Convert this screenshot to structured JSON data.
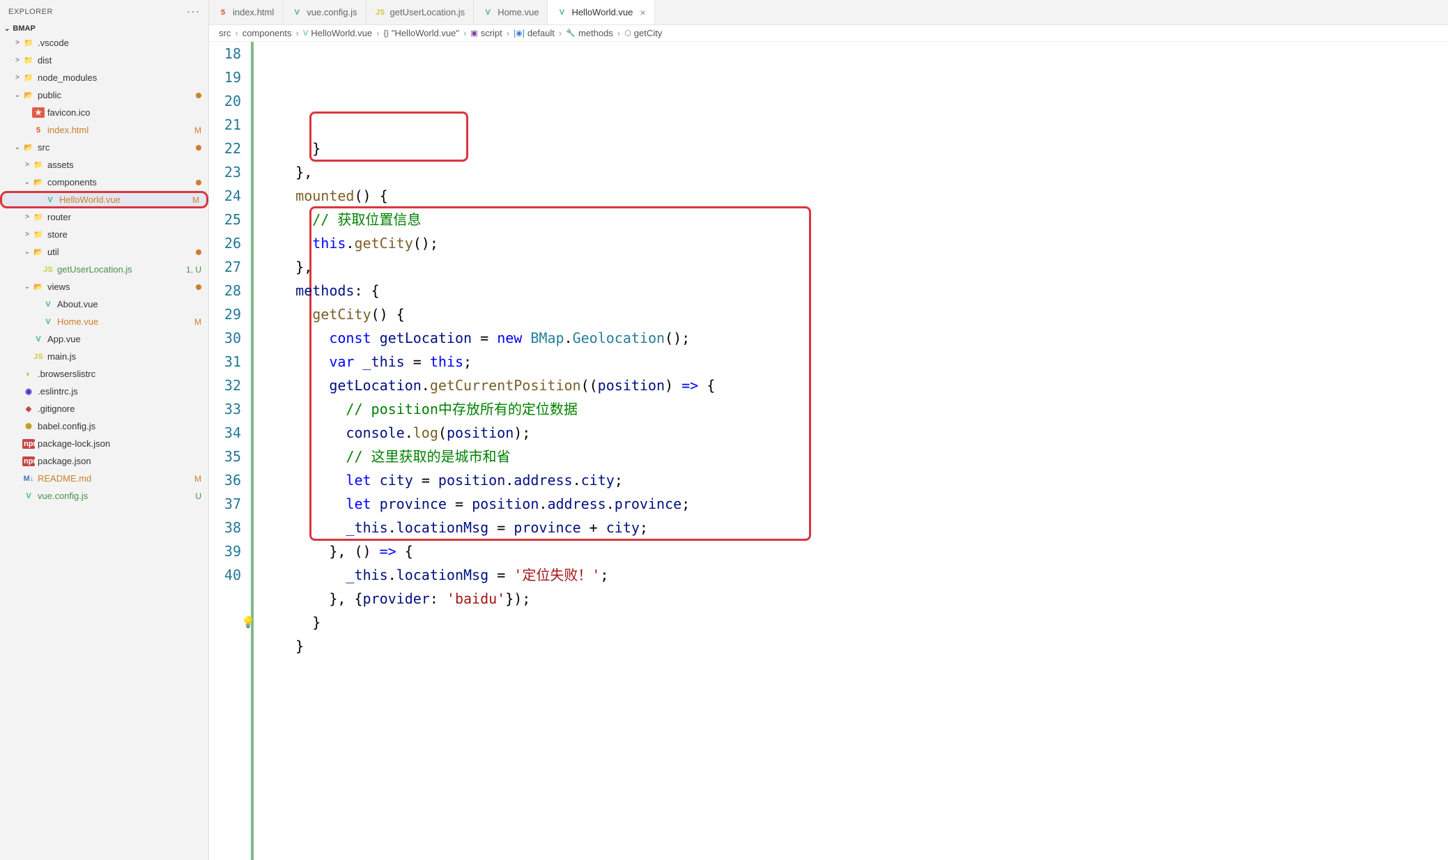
{
  "sidebar": {
    "title": "EXPLORER",
    "project": "BMAP",
    "tree": [
      {
        "indent": 1,
        "chev": ">",
        "icon": "📁",
        "iconClass": "",
        "label": ".vscode"
      },
      {
        "indent": 1,
        "chev": ">",
        "icon": "📁",
        "iconClass": "",
        "label": "dist"
      },
      {
        "indent": 1,
        "chev": ">",
        "icon": "📁",
        "iconClass": "ic-folder-open",
        "label": "node_modules"
      },
      {
        "indent": 1,
        "chev": "⌄",
        "icon": "📂",
        "iconClass": "",
        "label": "public",
        "dot": true
      },
      {
        "indent": 2,
        "chev": "",
        "icon": "★",
        "iconClass": "ic-star",
        "label": "favicon.ico"
      },
      {
        "indent": 2,
        "chev": "",
        "icon": "5",
        "iconClass": "ic-html",
        "label": "index.html",
        "status": "M",
        "git": "m"
      },
      {
        "indent": 1,
        "chev": "⌄",
        "icon": "📂",
        "iconClass": "",
        "label": "src",
        "dot": true
      },
      {
        "indent": 2,
        "chev": ">",
        "icon": "📁",
        "iconClass": "",
        "label": "assets"
      },
      {
        "indent": 2,
        "chev": "⌄",
        "icon": "📂",
        "iconClass": "",
        "label": "components",
        "dot": true
      },
      {
        "indent": 3,
        "chev": "",
        "icon": "V",
        "iconClass": "ic-vue",
        "label": "HelloWorld.vue",
        "status": "M",
        "git": "m",
        "selected": true,
        "boxed": true
      },
      {
        "indent": 2,
        "chev": ">",
        "icon": "📁",
        "iconClass": "",
        "label": "router"
      },
      {
        "indent": 2,
        "chev": ">",
        "icon": "📁",
        "iconClass": "",
        "label": "store"
      },
      {
        "indent": 2,
        "chev": "⌄",
        "icon": "📂",
        "iconClass": "",
        "label": "util",
        "dot": true
      },
      {
        "indent": 3,
        "chev": "",
        "icon": "JS",
        "iconClass": "ic-js",
        "label": "getUserLocation.js",
        "status": "1, U",
        "git": "u"
      },
      {
        "indent": 2,
        "chev": "⌄",
        "icon": "📂",
        "iconClass": "",
        "label": "views",
        "dot": true
      },
      {
        "indent": 3,
        "chev": "",
        "icon": "V",
        "iconClass": "ic-vue",
        "label": "About.vue"
      },
      {
        "indent": 3,
        "chev": "",
        "icon": "V",
        "iconClass": "ic-vue",
        "label": "Home.vue",
        "status": "M",
        "git": "m"
      },
      {
        "indent": 2,
        "chev": "",
        "icon": "V",
        "iconClass": "ic-vue",
        "label": "App.vue"
      },
      {
        "indent": 2,
        "chev": "",
        "icon": "JS",
        "iconClass": "ic-js",
        "label": "main.js"
      },
      {
        "indent": 1,
        "chev": "",
        "icon": "◐",
        "iconClass": "ic-browsers",
        "label": ".browserslistrc"
      },
      {
        "indent": 1,
        "chev": "",
        "icon": "◉",
        "iconClass": "ic-eslint",
        "label": ".eslintrc.js"
      },
      {
        "indent": 1,
        "chev": "",
        "icon": "◆",
        "iconClass": "ic-git",
        "label": ".gitignore"
      },
      {
        "indent": 1,
        "chev": "",
        "icon": "⬢",
        "iconClass": "ic-babel",
        "label": "babel.config.js"
      },
      {
        "indent": 1,
        "chev": "",
        "icon": "npm",
        "iconClass": "ic-pkg",
        "label": "package-lock.json"
      },
      {
        "indent": 1,
        "chev": "",
        "icon": "npm",
        "iconClass": "ic-pkg",
        "label": "package.json"
      },
      {
        "indent": 1,
        "chev": "",
        "icon": "M↓",
        "iconClass": "ic-md",
        "label": "README.md",
        "status": "M",
        "git": "m"
      },
      {
        "indent": 1,
        "chev": "",
        "icon": "V",
        "iconClass": "ic-vue",
        "label": "vue.config.js",
        "status": "U",
        "git": "u"
      }
    ]
  },
  "tabs": [
    {
      "icon": "5",
      "iconClass": "ic-html",
      "label": "index.html"
    },
    {
      "icon": "V",
      "iconClass": "ic-vue",
      "label": "vue.config.js"
    },
    {
      "icon": "JS",
      "iconClass": "ic-js",
      "label": "getUserLocation.js"
    },
    {
      "icon": "V",
      "iconClass": "ic-vue",
      "label": "Home.vue"
    },
    {
      "icon": "V",
      "iconClass": "ic-vue",
      "label": "HelloWorld.vue",
      "active": true,
      "close": true
    }
  ],
  "breadcrumb": [
    {
      "text": "src"
    },
    {
      "text": "components"
    },
    {
      "icon": "V",
      "iconClass": "ic-vue",
      "text": "HelloWorld.vue"
    },
    {
      "icon": "{}",
      "text": "\"HelloWorld.vue\""
    },
    {
      "icon": "▣",
      "iconColor": "#7a3e9d",
      "text": "script"
    },
    {
      "icon": "[◉]",
      "iconColor": "#3a7fc4",
      "text": "default"
    },
    {
      "icon": "🔧",
      "text": "methods"
    },
    {
      "icon": "⬡",
      "iconColor": "#8a6bbf",
      "text": "getCity"
    }
  ],
  "code": {
    "start": 18,
    "lines": [
      {
        "html": "      <span class='punc'>}</span>"
      },
      {
        "html": "    <span class='punc'>},</span>"
      },
      {
        "html": "    <span class='fn'>mounted</span><span class='punc'>() {</span>"
      },
      {
        "html": "      <span class='cmt'>// 获取位置信息</span>"
      },
      {
        "html": "      <span class='this'>this</span><span class='punc'>.</span><span class='fn'>getCity</span><span class='punc'>();</span>"
      },
      {
        "html": "    <span class='punc'>},</span>"
      },
      {
        "html": "    <span class='var'>methods</span><span class='punc'>: {</span>"
      },
      {
        "html": "      <span class='fn'>getCity</span><span class='punc'>() {</span>"
      },
      {
        "html": "        <span class='kw'>const</span> <span class='var'>getLocation</span> <span class='punc'>=</span> <span class='kw'>new</span> <span class='cls'>BMap</span><span class='punc'>.</span><span class='cls'>Geolocation</span><span class='punc'>();</span>"
      },
      {
        "html": "        <span class='kw'>var</span> <span class='var'>_this</span> <span class='punc'>=</span> <span class='this'>this</span><span class='punc'>;</span>"
      },
      {
        "html": "        <span class='var'>getLocation</span><span class='punc'>.</span><span class='fn'>getCurrentPosition</span><span class='punc'>((</span><span class='var'>position</span><span class='punc'>) </span><span class='kw'>=></span><span class='punc'> {</span>"
      },
      {
        "html": "          <span class='cmt'>// position中存放所有的定位数据</span>"
      },
      {
        "html": "          <span class='var'>console</span><span class='punc'>.</span><span class='fn'>log</span><span class='punc'>(</span><span class='var'>position</span><span class='punc'>);</span>"
      },
      {
        "html": "          <span class='cmt'>// 这里获取的是城市和省</span>"
      },
      {
        "html": "          <span class='kw'>let</span> <span class='var'>city</span> <span class='punc'>=</span> <span class='var'>position</span><span class='punc'>.</span><span class='prop'>address</span><span class='punc'>.</span><span class='prop'>city</span><span class='punc'>;</span>"
      },
      {
        "html": "          <span class='kw'>let</span> <span class='var'>province</span> <span class='punc'>=</span> <span class='var'>position</span><span class='punc'>.</span><span class='prop'>address</span><span class='punc'>.</span><span class='prop'>province</span><span class='punc'>;</span>"
      },
      {
        "html": "          <span class='var'>_this</span><span class='punc'>.</span><span class='prop'>locationMsg</span> <span class='punc'>=</span> <span class='var'>province</span> <span class='punc'>+</span> <span class='var'>city</span><span class='punc'>;</span>"
      },
      {
        "html": "        <span class='punc'>}, () </span><span class='kw'>=></span><span class='punc'> {</span>"
      },
      {
        "html": "          <span class='var'>_this</span><span class='punc'>.</span><span class='prop'>locationMsg</span> <span class='punc'>=</span> <span class='str'>'定位失败！'</span><span class='punc'>;</span>"
      },
      {
        "html": "        <span class='punc'>}, {</span><span class='var'>provider</span><span class='punc'>: </span><span class='str'>'baidu'</span><span class='punc'>});</span>"
      },
      {
        "html": "      <span class='punc'>}</span>",
        "bulb": true
      },
      {
        "html": "    <span class='punc'>}</span>"
      },
      {
        "html": ""
      }
    ]
  },
  "highlights": {
    "box1": {
      "topLine": 21,
      "leftCh": 6,
      "heightLines": 2,
      "widthCh": 19
    },
    "box2": {
      "topLine": 25,
      "leftCh": 6,
      "heightLines": 14,
      "widthCh": 60
    }
  }
}
